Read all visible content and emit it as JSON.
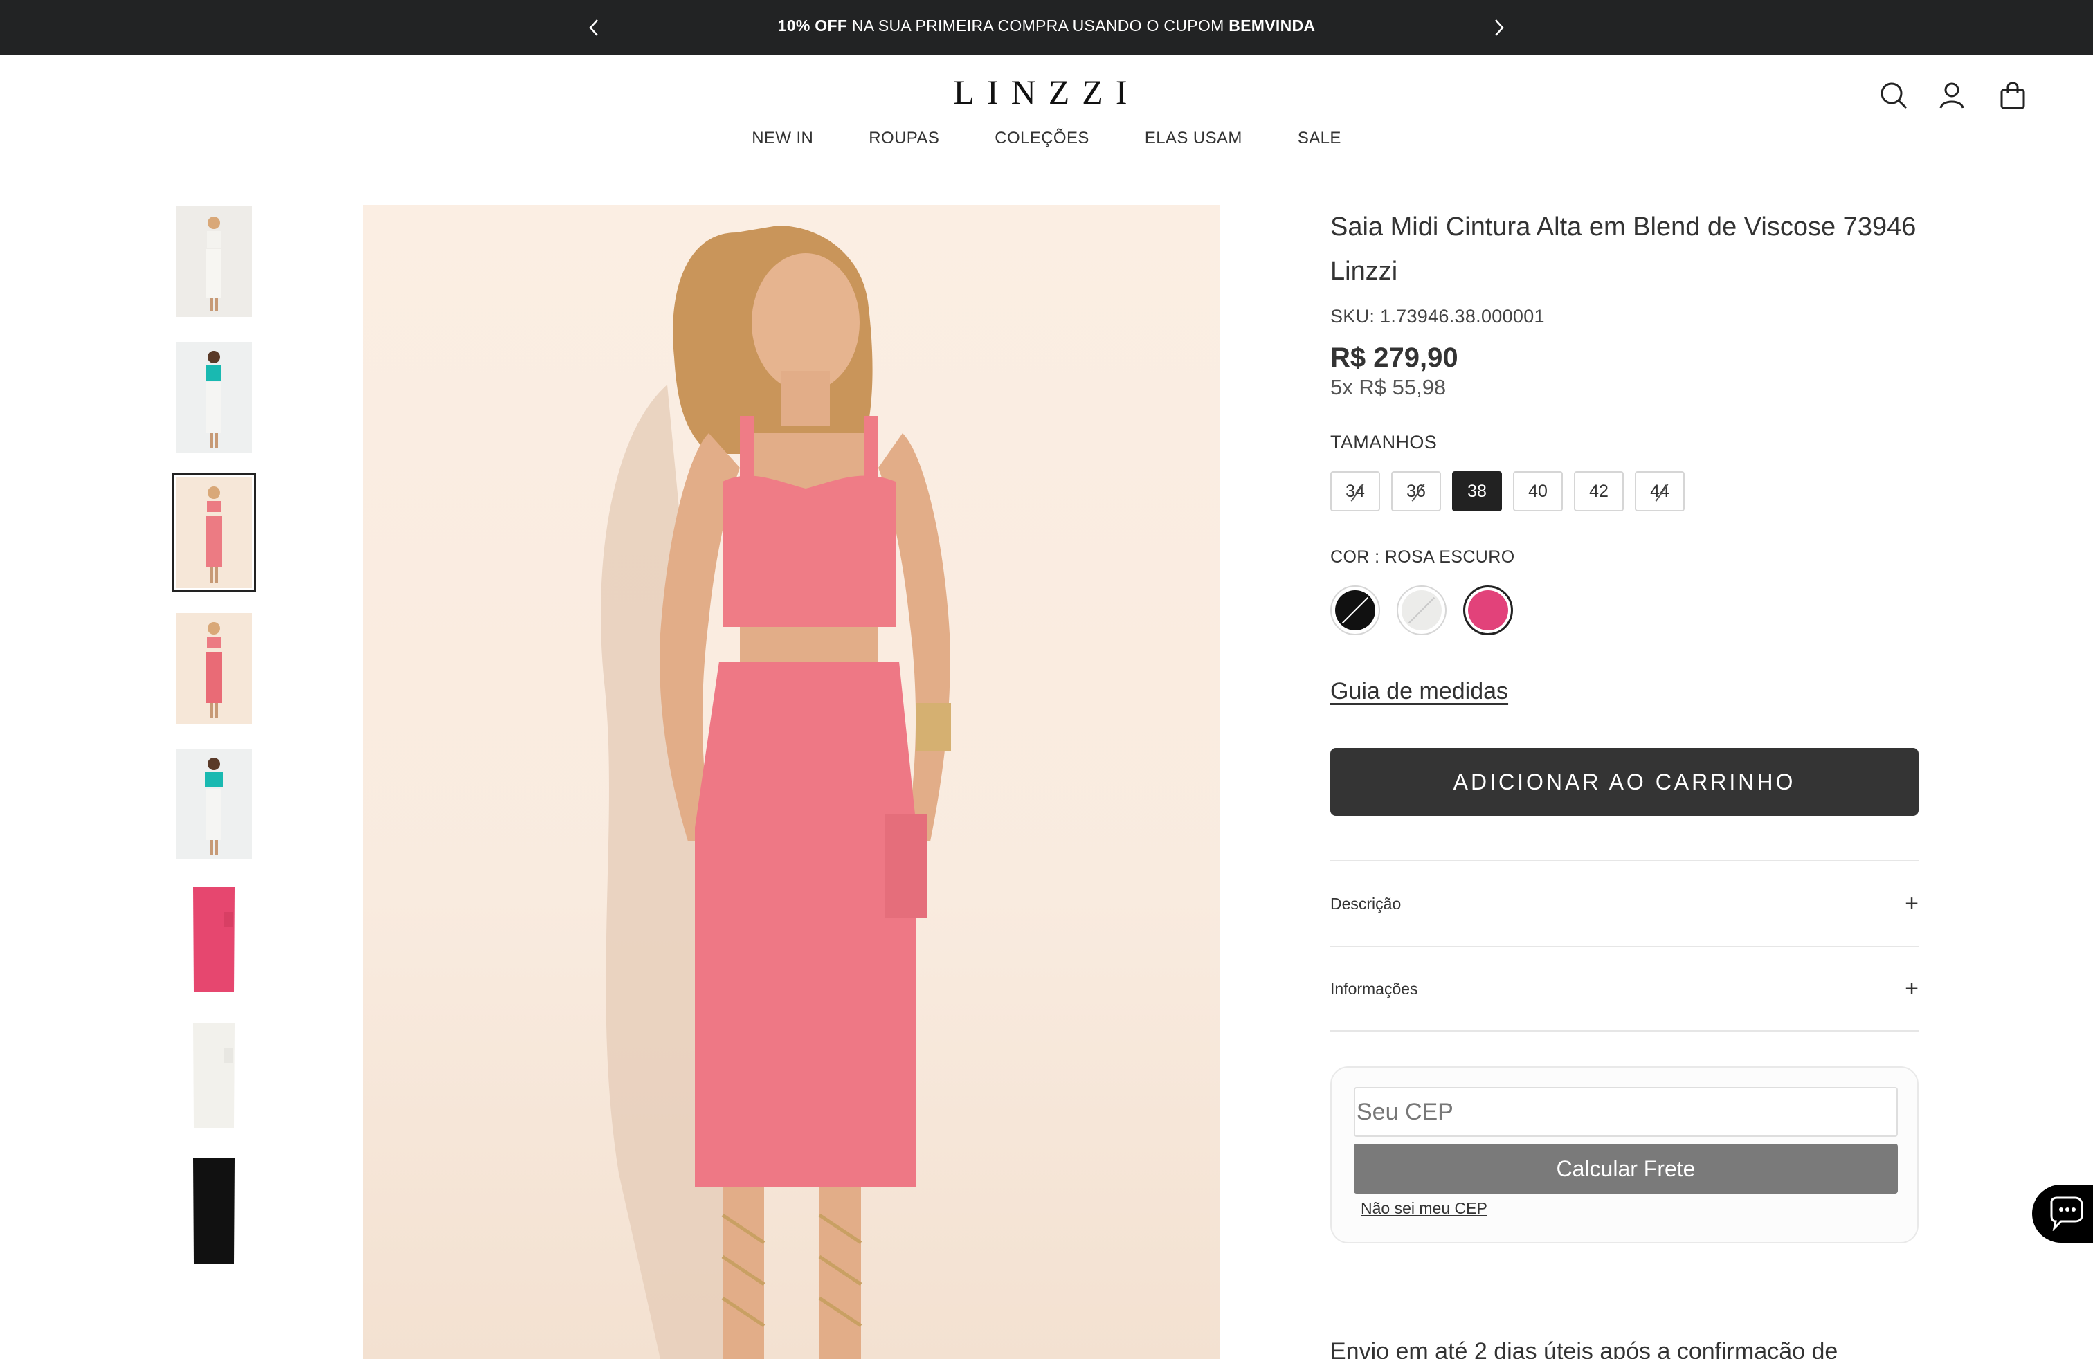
{
  "announcement": {
    "prefix_bold": "10% OFF",
    "middle": " NA SUA PRIMEIRA COMPRA USANDO O CUPOM ",
    "coupon": "BEMVINDA"
  },
  "header": {
    "logo": "LINZZI",
    "nav": [
      "NEW IN",
      "ROUPAS",
      "COLEÇÕES",
      "ELAS USAM",
      "SALE"
    ],
    "icons": [
      "search-icon",
      "account-icon",
      "cart-icon"
    ]
  },
  "gallery": {
    "thumbnails": [
      "model-white-outfit",
      "model-teal-top-white-skirt",
      "model-pink-set",
      "model-pink-set-back",
      "model-teal-top-white-skirt-2",
      "pink-skirt-flat",
      "white-skirt-flat",
      "black-skirt-flat"
    ],
    "active_index": 2
  },
  "product": {
    "title": "Saia Midi Cintura Alta em Blend de Viscose 73946 Linzzi",
    "sku": "SKU: 1.73946.38.000001",
    "price": "R$ 279,90",
    "installments": "5x R$ 55,98",
    "sizes_label": "TAMANHOS",
    "sizes": [
      {
        "label": "34",
        "available": false
      },
      {
        "label": "36",
        "available": false
      },
      {
        "label": "38",
        "available": true,
        "selected": true
      },
      {
        "label": "40",
        "available": true
      },
      {
        "label": "42",
        "available": true
      },
      {
        "label": "44",
        "available": false
      }
    ],
    "color_label": "COR : ROSA ESCURO",
    "colors": [
      {
        "name": "preto",
        "hex": "#111111"
      },
      {
        "name": "off-white",
        "hex": "#ececea"
      },
      {
        "name": "rosa-escuro",
        "hex": "#e2427a",
        "selected": true
      }
    ],
    "size_guide": "Guia de medidas",
    "add_to_cart": "ADICIONAR AO CARRINHO",
    "accordion": [
      "Descrição",
      "Informações"
    ],
    "shipping": {
      "placeholder": "Seu CEP",
      "button": "Calcular Frete",
      "no_cep": "Não sei meu CEP"
    },
    "delivery_note": "Envio em até 2 dias úteis após a confirmação de"
  }
}
